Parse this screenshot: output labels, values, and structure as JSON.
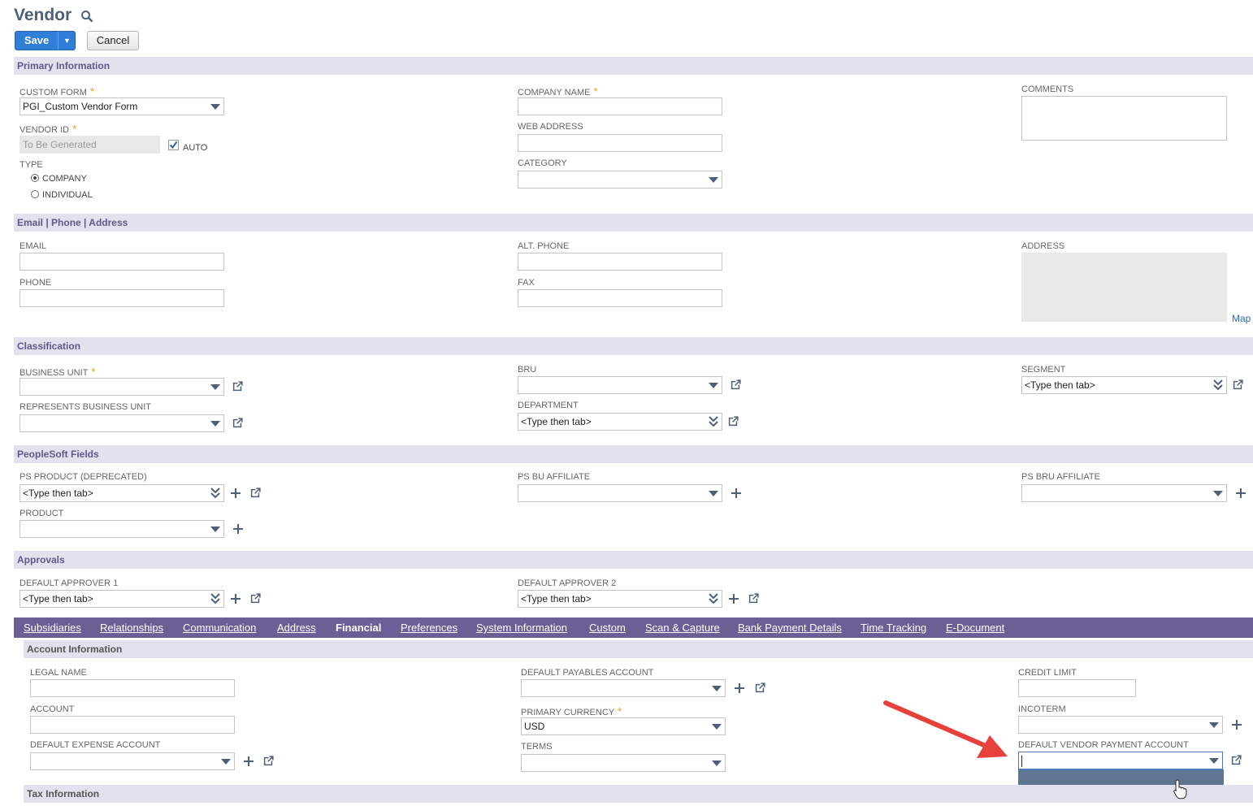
{
  "header": {
    "title": "Vendor",
    "save_label": "Save",
    "cancel_label": "Cancel"
  },
  "sections": {
    "primary": "Primary Information",
    "contact": "Email | Phone | Address",
    "classification": "Classification",
    "peoplesoft": "PeopleSoft Fields",
    "approvals": "Approvals"
  },
  "primary": {
    "custom_form_label": "CUSTOM FORM",
    "custom_form_value": "PGI_Custom Vendor Form",
    "vendor_id_label": "VENDOR ID",
    "vendor_id_value": "To Be Generated",
    "auto_label": "AUTO",
    "type_label": "TYPE",
    "type_company": "COMPANY",
    "type_individual": "INDIVIDUAL",
    "company_name_label": "COMPANY NAME",
    "web_address_label": "WEB ADDRESS",
    "category_label": "CATEGORY",
    "comments_label": "COMMENTS"
  },
  "contact": {
    "email_label": "EMAIL",
    "phone_label": "PHONE",
    "alt_phone_label": "ALT. PHONE",
    "fax_label": "FAX",
    "address_label": "ADDRESS",
    "map_link": "Map"
  },
  "classification": {
    "business_unit_label": "BUSINESS UNIT",
    "represents_bu_label": "REPRESENTS BUSINESS UNIT",
    "bru_label": "BRU",
    "department_label": "DEPARTMENT",
    "department_value": "<Type then tab>",
    "segment_label": "SEGMENT",
    "segment_value": "<Type then tab>"
  },
  "peoplesoft": {
    "ps_product_label": "PS PRODUCT (DEPRECATED)",
    "ps_product_value": "<Type then tab>",
    "product_label": "PRODUCT",
    "ps_bu_affiliate_label": "PS BU AFFILIATE",
    "ps_bru_affiliate_label": "PS BRU AFFILIATE"
  },
  "approvals": {
    "approver1_label": "DEFAULT APPROVER 1",
    "approver1_value": "<Type then tab>",
    "approver2_label": "DEFAULT APPROVER 2",
    "approver2_value": "<Type then tab>"
  },
  "tabs": [
    "Subsidiaries",
    "Relationships",
    "Communication",
    "Address",
    "Financial",
    "Preferences",
    "System Information",
    "Custom",
    "Scan & Capture",
    "Bank Payment Details",
    "Time Tracking",
    "E-Document"
  ],
  "active_tab": "Financial",
  "financial": {
    "account_info_title": "Account Information",
    "legal_name_label": "LEGAL NAME",
    "account_label": "ACCOUNT",
    "default_expense_label": "DEFAULT EXPENSE ACCOUNT",
    "default_payables_label": "DEFAULT PAYABLES ACCOUNT",
    "primary_currency_label": "PRIMARY CURRENCY",
    "primary_currency_value": "USD",
    "terms_label": "TERMS",
    "credit_limit_label": "CREDIT LIMIT",
    "incoterm_label": "INCOTERM",
    "default_vendor_payment_label": "DEFAULT VENDOR PAYMENT ACCOUNT",
    "tax_info_title": "Tax Information"
  },
  "colors": {
    "tab_bar": "#6d5f96",
    "section_bg": "#e3e1ee",
    "save_button": "#2f7ed8",
    "annotation_arrow": "#e8413b",
    "dropdown_highlight": "#5f7592"
  }
}
